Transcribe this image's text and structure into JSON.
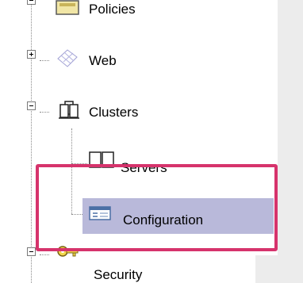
{
  "tree": {
    "items": [
      {
        "label": "Policies"
      },
      {
        "label": "Web"
      },
      {
        "label": "Clusters"
      },
      {
        "label": "Servers"
      },
      {
        "label": "Configuration"
      },
      {
        "label": "Security"
      }
    ]
  },
  "colors": {
    "selection": "#b9b9da",
    "highlight_box": "#d6336c"
  }
}
